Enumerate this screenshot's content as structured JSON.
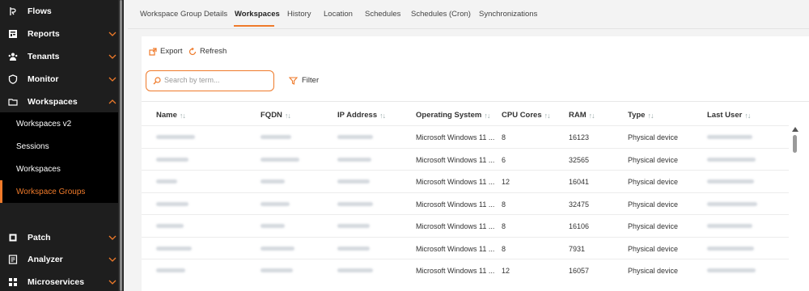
{
  "sidebar": {
    "items": [
      {
        "label": "Flows",
        "icon": "flows-icon"
      },
      {
        "label": "Reports",
        "icon": "reports-icon"
      },
      {
        "label": "Tenants",
        "icon": "tenants-icon"
      },
      {
        "label": "Monitor",
        "icon": "monitor-icon"
      },
      {
        "label": "Workspaces",
        "icon": "workspaces-icon"
      },
      {
        "label": "Patch",
        "icon": "patch-icon"
      },
      {
        "label": "Analyzer",
        "icon": "analyzer-icon"
      },
      {
        "label": "Microservices",
        "icon": "microservices-icon"
      }
    ],
    "sub_items": [
      "Workspaces v2",
      "Sessions",
      "Workspaces",
      "Workspace Groups"
    ],
    "active_sub": "Workspace Groups"
  },
  "tabs": [
    "Workspace Group Details",
    "Workspaces",
    "History",
    "Location",
    "Schedules",
    "Schedules (Cron)",
    "Synchronizations"
  ],
  "active_tab": "Workspaces",
  "toolbar": {
    "export_label": "Export",
    "refresh_label": "Refresh",
    "filter_label": "Filter"
  },
  "search": {
    "placeholder": "Search by term..."
  },
  "table": {
    "columns": [
      "Name",
      "FQDN",
      "IP Address",
      "Operating System",
      "CPU Cores",
      "RAM",
      "Type",
      "Last User"
    ],
    "rows": [
      {
        "os": "Microsoft Windows 11 ...",
        "cpu": "8",
        "ram": "16123",
        "type": "Physical device"
      },
      {
        "os": "Microsoft Windows 11 ...",
        "cpu": "6",
        "ram": "32565",
        "type": "Physical device"
      },
      {
        "os": "Microsoft Windows 11 ...",
        "cpu": "12",
        "ram": "16041",
        "type": "Physical device"
      },
      {
        "os": "Microsoft Windows 11 ...",
        "cpu": "8",
        "ram": "32475",
        "type": "Physical device"
      },
      {
        "os": "Microsoft Windows 11 ...",
        "cpu": "8",
        "ram": "16106",
        "type": "Physical device"
      },
      {
        "os": "Microsoft Windows 11 ...",
        "cpu": "8",
        "ram": "7931",
        "type": "Physical device"
      },
      {
        "os": "Microsoft Windows 11 ...",
        "cpu": "12",
        "ram": "16057",
        "type": "Physical device"
      }
    ]
  },
  "colors": {
    "accent": "#ef7a2a",
    "sidebar_bg": "#1e1e1e",
    "submenu_bg": "#000000"
  }
}
